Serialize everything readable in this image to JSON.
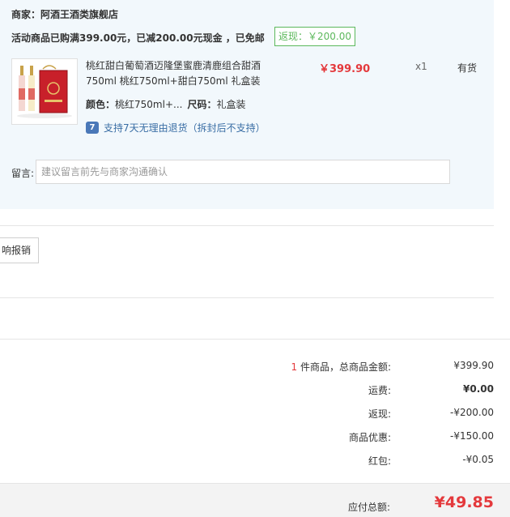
{
  "merchant": {
    "label": "商家：",
    "name": "阿酒王酒类旗舰店"
  },
  "promo": {
    "text": "活动商品已购满399.00元，已减200.00元现金 ，已免邮",
    "rebate_badge": "返现：￥200.00"
  },
  "product": {
    "title": "桃红甜白葡萄酒迈隆堡蜜鹿清鹿组合甜酒750ml 桃红750ml+甜白750ml 礼盒装",
    "price": "￥399.90",
    "quantity": "x1",
    "stock": "有货",
    "color_label": "颜色：",
    "color_value": "桃红750ml+...",
    "size_label": "尺码：",
    "size_value": "礼盒装",
    "return_icon": "7",
    "return_policy": "支持7天无理由退货（拆封后不支持）"
  },
  "message": {
    "label": "留言:",
    "placeholder": "建议留言前先与商家沟通确认"
  },
  "invoice": {
    "button_label": "响报销"
  },
  "summary": {
    "count": "1",
    "count_suffix": " 件商品，总商品金额:",
    "goods_total": "¥399.90",
    "shipping_label": "运费:",
    "shipping_value": "¥0.00",
    "rebate_label": "返现:",
    "rebate_value": "-¥200.00",
    "discount_label": "商品优惠:",
    "discount_value": "-¥150.00",
    "redpacket_label": "红包:",
    "redpacket_value": "-¥0.05"
  },
  "total": {
    "label": "应付总额:",
    "value": "¥49.85"
  },
  "colors": {
    "accent_red": "#e4393c",
    "rebate_green": "#5cb85c",
    "panel_bg": "#f2f8fc",
    "link_blue": "#3a6ea5"
  },
  "icons": {
    "return_badge": "return-badge-icon",
    "product_image": "wine-gift-set-image"
  }
}
